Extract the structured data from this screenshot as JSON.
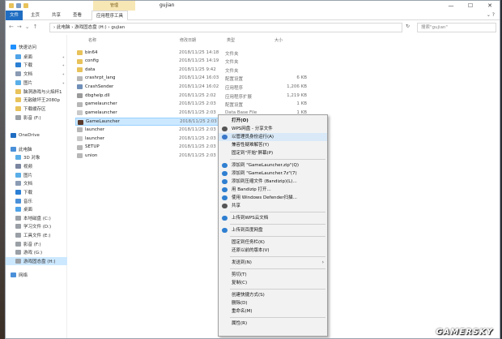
{
  "window": {
    "title": "gujian",
    "context_tab": "管理",
    "controls": [
      "—",
      "☐",
      "✕"
    ]
  },
  "ribbon": {
    "tabs": [
      "文件",
      "主页",
      "共享",
      "查看",
      "应用程序工具"
    ],
    "right": "⌄ ?"
  },
  "address": {
    "path": "› 此电脑 › 游戏固态盘 (H:) › gujian",
    "search_placeholder": "搜索\"gujian\""
  },
  "nav_pane": [
    {
      "label": "快速访问",
      "icon": "star-icon",
      "color": "#1e90ff",
      "pinned": false,
      "selected": false
    },
    {
      "label": "桌面",
      "icon": "desktop-icon",
      "color": "#4fa3e8",
      "pinned": true,
      "selected": false
    },
    {
      "label": "下载",
      "icon": "download-icon",
      "color": "#2a7fd4",
      "pinned": true,
      "selected": false
    },
    {
      "label": "文档",
      "icon": "document-icon",
      "color": "#8a9bb3",
      "pinned": true,
      "selected": false
    },
    {
      "label": "图片",
      "icon": "picture-icon",
      "color": "#5aaee8",
      "pinned": true,
      "selected": false
    },
    {
      "label": "脑洞游戏与火焰杯1",
      "icon": "folder-icon",
      "color": "#e8c25a",
      "pinned": false,
      "selected": false
    },
    {
      "label": "无敌破坏王2080p",
      "icon": "folder-icon",
      "color": "#e8c25a",
      "pinned": false,
      "selected": false
    },
    {
      "label": "下载缓存区",
      "icon": "folder-icon",
      "color": "#e8c25a",
      "pinned": false,
      "selected": false
    },
    {
      "label": "影音 (F:)",
      "icon": "drive-icon",
      "color": "#9aa0a6",
      "pinned": false,
      "selected": false
    },
    {
      "label": "OneDrive",
      "icon": "cloud-icon",
      "color": "#1f6dc2",
      "pinned": false,
      "selected": false
    },
    {
      "label": "此电脑",
      "icon": "computer-icon",
      "color": "#4a90d9",
      "pinned": false,
      "selected": false
    },
    {
      "label": "3D 对象",
      "icon": "cube-icon",
      "color": "#5aaee8",
      "pinned": false,
      "selected": false
    },
    {
      "label": "视频",
      "icon": "video-icon",
      "color": "#7a86a0",
      "pinned": false,
      "selected": false
    },
    {
      "label": "图片",
      "icon": "picture-icon",
      "color": "#5aaee8",
      "pinned": false,
      "selected": false
    },
    {
      "label": "文档",
      "icon": "document-icon",
      "color": "#8a9bb3",
      "pinned": false,
      "selected": false
    },
    {
      "label": "下载",
      "icon": "download-icon",
      "color": "#2a7fd4",
      "pinned": false,
      "selected": false
    },
    {
      "label": "音乐",
      "icon": "music-icon",
      "color": "#4a90d9",
      "pinned": false,
      "selected": false
    },
    {
      "label": "桌面",
      "icon": "desktop-icon",
      "color": "#4fa3e8",
      "pinned": false,
      "selected": false
    },
    {
      "label": "本地磁盘 (C:)",
      "icon": "drive-icon",
      "color": "#9aa0a6",
      "pinned": false,
      "selected": false
    },
    {
      "label": "学习文件 (D:)",
      "icon": "drive-icon",
      "color": "#9aa0a6",
      "pinned": false,
      "selected": false
    },
    {
      "label": "工具文件 (E:)",
      "icon": "drive-icon",
      "color": "#9aa0a6",
      "pinned": false,
      "selected": false
    },
    {
      "label": "影音 (F:)",
      "icon": "drive-icon",
      "color": "#9aa0a6",
      "pinned": false,
      "selected": false
    },
    {
      "label": "游戏 (G:)",
      "icon": "drive-icon",
      "color": "#9aa0a6",
      "pinned": false,
      "selected": false
    },
    {
      "label": "游戏固态盘 (H:)",
      "icon": "drive-icon",
      "color": "#9aa0a6",
      "pinned": false,
      "selected": true
    },
    {
      "label": "网络",
      "icon": "network-icon",
      "color": "#4a90d9",
      "pinned": false,
      "selected": false
    }
  ],
  "columns": [
    "名称",
    "修改日期",
    "类型",
    "大小"
  ],
  "files": [
    {
      "name": "bin64",
      "date": "2018/11/25 14:18",
      "type": "文件夹",
      "size": "",
      "icon": "folder-icon",
      "color": "#e8c25a"
    },
    {
      "name": "config",
      "date": "2018/11/25 14:19",
      "type": "文件夹",
      "size": "",
      "icon": "folder-icon",
      "color": "#e8c25a"
    },
    {
      "name": "data",
      "date": "2018/11/25 9:42",
      "type": "文件夹",
      "size": "",
      "icon": "folder-icon",
      "color": "#e8c25a"
    },
    {
      "name": "crashrpt_lang",
      "date": "2018/11/24 16:03",
      "type": "配置设置",
      "size": "6 KB",
      "icon": "settings-file-icon",
      "color": "#b7b7b7"
    },
    {
      "name": "CrashSender",
      "date": "2018/11/24 16:02",
      "type": "应用程序",
      "size": "1,206 KB",
      "icon": "app-icon",
      "color": "#6f8fb8"
    },
    {
      "name": "dbghelp.dll",
      "date": "2018/11/25 2:02",
      "type": "应用程序扩展",
      "size": "1,219 KB",
      "icon": "dll-icon",
      "color": "#9a9a9a"
    },
    {
      "name": "gamelauncher",
      "date": "2018/11/25 2:03",
      "type": "配置设置",
      "size": "1 KB",
      "icon": "settings-file-icon",
      "color": "#b7b7b7"
    },
    {
      "name": "gamelauncher",
      "date": "2018/11/25 2:03",
      "type": "Data Base File",
      "size": "1 KB",
      "icon": "db-file-icon",
      "color": "#c9c9c9"
    },
    {
      "name": "GameLauncher",
      "date": "2018/11/25 2:03",
      "type": "应用程序",
      "size": "2,178 KB",
      "icon": "app-icon",
      "color": "#5a3a2a",
      "selected": true
    },
    {
      "name": "launcher",
      "date": "2018/11/25 2:03",
      "type": "",
      "size": "",
      "icon": "settings-file-icon",
      "color": "#b7b7b7"
    },
    {
      "name": "launcher",
      "date": "2018/11/25 2:03",
      "type": "",
      "size": "",
      "icon": "db-file-icon",
      "color": "#c9c9c9"
    },
    {
      "name": "SETUP",
      "date": "2018/11/25 2:03",
      "type": "",
      "size": "",
      "icon": "settings-file-icon",
      "color": "#b7b7b7"
    },
    {
      "name": "union",
      "date": "2018/11/25 2:03",
      "type": "",
      "size": "",
      "icon": "settings-file-icon",
      "color": "#b7b7b7"
    }
  ],
  "context_menu": [
    {
      "label": "打开(O)",
      "bold": true,
      "icon": ""
    },
    {
      "label": "WPS网盘 - 分享文件",
      "icon": "share-icon",
      "color": "#555555"
    },
    {
      "label": "以管理员身份运行(A)",
      "icon": "shield-icon",
      "color": "#3a78c9",
      "highlight": true
    },
    {
      "label": "兼容性疑难解答(Y)",
      "icon": ""
    },
    {
      "label": "固定到\"开始\"屏幕(P)",
      "icon": ""
    },
    {
      "sep": true
    },
    {
      "label": "添加到 \"GameLauncher.zip\"(Q)",
      "icon": "bandizip-icon",
      "color": "#2f7fd1"
    },
    {
      "label": "添加到 \"GameLauncher.7z\"(7)",
      "icon": "bandizip-icon",
      "color": "#2f7fd1"
    },
    {
      "label": "添加到压缩文件 (Bandizip)(L)...",
      "icon": "bandizip-icon",
      "color": "#2f7fd1"
    },
    {
      "label": "用 Bandizip 打开...",
      "icon": "bandizip-icon",
      "color": "#2f7fd1"
    },
    {
      "label": "使用 Windows Defender扫描...",
      "icon": "defender-icon",
      "color": "#2f7fd1"
    },
    {
      "label": "共享",
      "icon": "share-icon",
      "color": "#555555"
    },
    {
      "sep": true
    },
    {
      "label": "上传到WPS云文档",
      "icon": "cloud-upload-icon",
      "color": "#2f7fd1"
    },
    {
      "sep": true
    },
    {
      "label": "上传到百度网盘",
      "icon": "baidu-icon",
      "color": "#2f7fd1"
    },
    {
      "sep": true
    },
    {
      "label": "固定到任务栏(K)",
      "icon": ""
    },
    {
      "label": "还原以前的版本(V)",
      "icon": ""
    },
    {
      "sep": true
    },
    {
      "label": "发送到(N)",
      "icon": "",
      "submenu": true
    },
    {
      "sep": true
    },
    {
      "label": "剪切(T)",
      "icon": ""
    },
    {
      "label": "复制(C)",
      "icon": ""
    },
    {
      "sep": true
    },
    {
      "label": "创建快捷方式(S)",
      "icon": ""
    },
    {
      "label": "删除(D)",
      "icon": ""
    },
    {
      "label": "重命名(M)",
      "icon": ""
    },
    {
      "sep": true
    },
    {
      "label": "属性(R)",
      "icon": ""
    }
  ],
  "watermark": "GAMERSKY"
}
